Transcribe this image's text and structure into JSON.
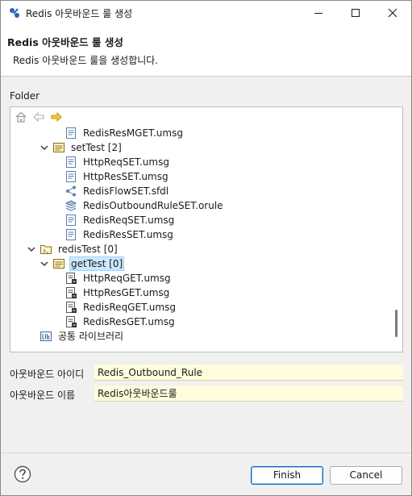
{
  "window": {
    "title": "Redis 아웃바운드 룰 생성"
  },
  "banner": {
    "title": "Redis 아웃바운드 룰 생성",
    "subtitle": "Redis 아웃바운드 룰을 생성합니다."
  },
  "folder": {
    "label": "Folder"
  },
  "tree": {
    "items": [
      {
        "label": "RedisResMGET.umsg",
        "icon": "message-file-icon"
      },
      {
        "label": "setTest [2]",
        "icon": "package-icon"
      },
      {
        "label": "HttpReqSET.umsg",
        "icon": "message-file-icon"
      },
      {
        "label": "HttpResSET.umsg",
        "icon": "message-file-icon"
      },
      {
        "label": "RedisFlowSET.sfdl",
        "icon": "flow-icon"
      },
      {
        "label": "RedisOutboundRuleSET.orule",
        "icon": "rule-layers-icon"
      },
      {
        "label": "RedisReqSET.umsg",
        "icon": "message-file-icon"
      },
      {
        "label": "RedisResSET.umsg",
        "icon": "message-file-icon"
      },
      {
        "label": "redisTest [0]",
        "icon": "project-folder-icon"
      },
      {
        "label": "getTest [0]",
        "icon": "package-icon"
      },
      {
        "label": "HttpReqGET.umsg",
        "icon": "message-file-modified-icon"
      },
      {
        "label": "HttpResGET.umsg",
        "icon": "message-file-modified-icon"
      },
      {
        "label": "RedisReqGET.umsg",
        "icon": "message-file-modified-icon"
      },
      {
        "label": "RedisResGET.umsg",
        "icon": "message-file-modified-icon"
      },
      {
        "label": "공통 라이브러리",
        "icon": "library-icon"
      }
    ]
  },
  "form": {
    "id_label": "아웃바운드 아이디",
    "id_value": "Redis_Outbound_Rule",
    "name_label": "아웃바운드 이름",
    "name_value": "Redis아웃바운드룰"
  },
  "buttons": {
    "finish": "Finish",
    "cancel": "Cancel"
  },
  "colors": {
    "accent": "#0067c0",
    "selection": "#cce8ff",
    "input_bg": "#fffcdc"
  }
}
